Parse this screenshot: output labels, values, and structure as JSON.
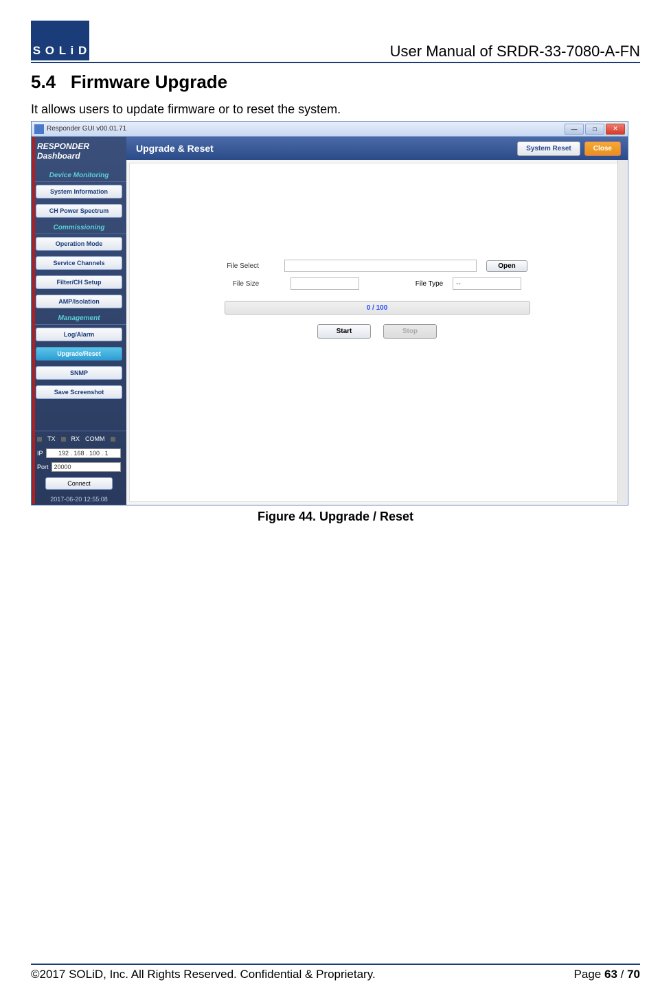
{
  "header": {
    "logo_text": "S O L i D",
    "title": "User Manual of SRDR-33-7080-A-FN"
  },
  "section": {
    "number": "5.4",
    "title": "Firmware Upgrade",
    "description": "It allows users to update firmware or to reset the system."
  },
  "app": {
    "window_title": "Responder GUI v00.01.71",
    "sidebar": {
      "dashboard_title_1": "RESPONDER",
      "dashboard_title_2": "Dashboard",
      "sections": {
        "monitoring": {
          "label": "Device Monitoring",
          "items": [
            "System Information",
            "CH Power Spectrum"
          ]
        },
        "commissioning": {
          "label": "Commissioning",
          "items": [
            "Operation Mode",
            "Service Channels",
            "Filter/CH Setup",
            "AMP/Isolation"
          ]
        },
        "management": {
          "label": "Management",
          "items": [
            "Log/Alarm",
            "Upgrade/Reset",
            "SNMP",
            "Save Screenshot"
          ]
        }
      },
      "status": {
        "tx": "TX",
        "rx": "RX",
        "comm": "COMM"
      },
      "ip_label": "IP",
      "ip_value": "192 . 168 . 100 .   1",
      "port_label": "Port",
      "port_value": "20000",
      "connect_label": "Connect",
      "timestamp": "2017-06-20 12:55:08"
    },
    "main": {
      "title": "Upgrade & Reset",
      "system_reset": "System Reset",
      "close": "Close",
      "file_select_label": "File Select",
      "file_size_label": "File Size",
      "file_type_label": "File Type",
      "file_type_value": "--",
      "open_btn": "Open",
      "progress_text": "0 / 100",
      "start_btn": "Start",
      "stop_btn": "Stop"
    }
  },
  "figure_caption": "Figure 44. Upgrade / Reset",
  "footer": {
    "copyright": "©2017 SOLiD, Inc. All Rights Reserved. Confidential & Proprietary.",
    "page_label": "Page ",
    "page_current": "63",
    "page_sep": " / ",
    "page_total": "70"
  }
}
